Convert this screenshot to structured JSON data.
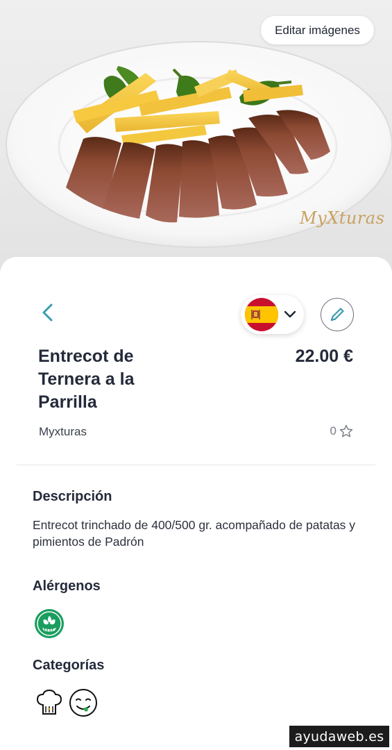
{
  "hero": {
    "edit_images_label": "Editar imágenes",
    "watermark_logo": "MyXturas"
  },
  "header": {
    "back_icon": "chevron-left-icon",
    "language_flag": "spain-flag-icon",
    "language_dropdown_icon": "chevron-down-icon",
    "edit_icon": "pencil-icon"
  },
  "dish": {
    "title": "Entrecot de Ternera a la Parrilla",
    "price": "22.00 €",
    "restaurant": "Myxturas",
    "rating_count": "0"
  },
  "description": {
    "heading": "Descripción",
    "text": "Entrecot trinchado de 400/500 gr. acompañado de patatas y pimientos de Padrón"
  },
  "allergens": {
    "heading": "Alérgenos",
    "items": [
      {
        "icon": "celery-allergen-icon"
      }
    ]
  },
  "categories": {
    "heading": "Categorías",
    "items": [
      {
        "icon": "chef-hat-icon"
      },
      {
        "icon": "tasty-face-icon"
      }
    ]
  },
  "footer_watermark": "ayudaweb.es",
  "colors": {
    "accent": "#3a9bb0",
    "allergen_green": "#1a9e5f",
    "flag_red": "#c8102e",
    "flag_yellow": "#ffc400"
  }
}
